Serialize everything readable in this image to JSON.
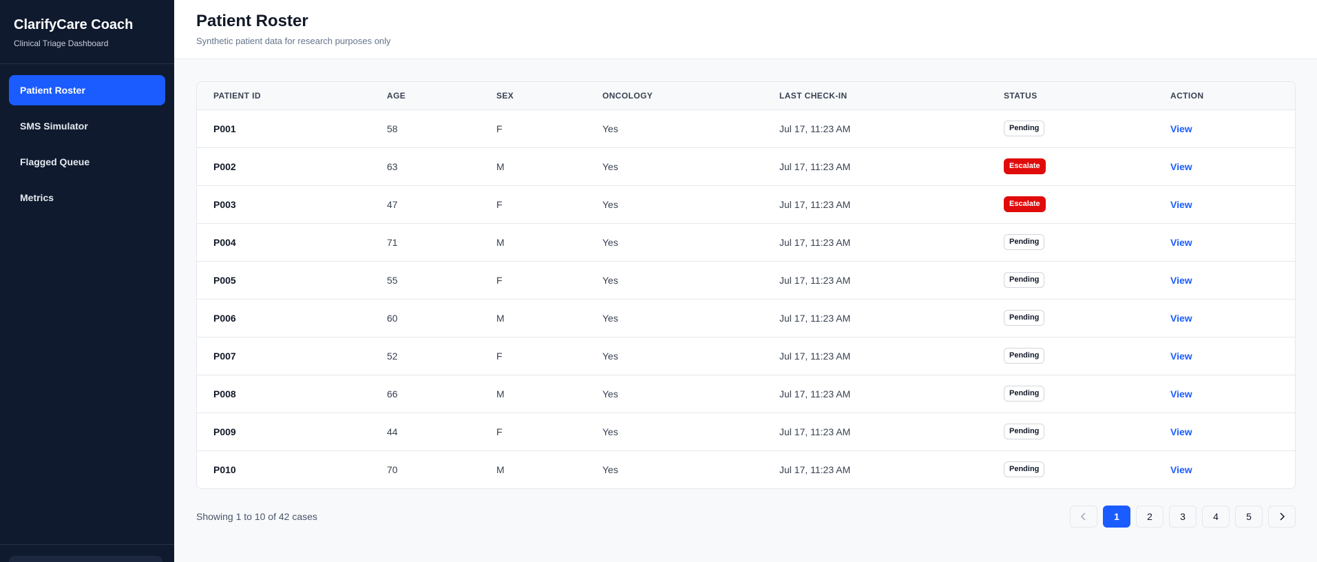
{
  "brand": {
    "title": "ClarifyCare Coach",
    "subtitle": "Clinical Triage Dashboard"
  },
  "nav": [
    {
      "label": "Patient Roster",
      "active": true
    },
    {
      "label": "SMS Simulator",
      "active": false
    },
    {
      "label": "Flagged Queue",
      "active": false
    },
    {
      "label": "Metrics",
      "active": false
    }
  ],
  "header": {
    "title": "Patient Roster",
    "subtitle": "Synthetic patient data for research purposes only"
  },
  "table": {
    "columns": [
      "PATIENT ID",
      "AGE",
      "SEX",
      "ONCOLOGY",
      "LAST CHECK-IN",
      "STATUS",
      "ACTION"
    ],
    "rows": [
      {
        "id": "P001",
        "age": "58",
        "sex": "F",
        "oncology": "Yes",
        "checkin": "Jul 17, 11:23 AM",
        "status": "Pending",
        "action": "View"
      },
      {
        "id": "P002",
        "age": "63",
        "sex": "M",
        "oncology": "Yes",
        "checkin": "Jul 17, 11:23 AM",
        "status": "Escalate",
        "action": "View"
      },
      {
        "id": "P003",
        "age": "47",
        "sex": "F",
        "oncology": "Yes",
        "checkin": "Jul 17, 11:23 AM",
        "status": "Escalate",
        "action": "View"
      },
      {
        "id": "P004",
        "age": "71",
        "sex": "M",
        "oncology": "Yes",
        "checkin": "Jul 17, 11:23 AM",
        "status": "Pending",
        "action": "View"
      },
      {
        "id": "P005",
        "age": "55",
        "sex": "F",
        "oncology": "Yes",
        "checkin": "Jul 17, 11:23 AM",
        "status": "Pending",
        "action": "View"
      },
      {
        "id": "P006",
        "age": "60",
        "sex": "M",
        "oncology": "Yes",
        "checkin": "Jul 17, 11:23 AM",
        "status": "Pending",
        "action": "View"
      },
      {
        "id": "P007",
        "age": "52",
        "sex": "F",
        "oncology": "Yes",
        "checkin": "Jul 17, 11:23 AM",
        "status": "Pending",
        "action": "View"
      },
      {
        "id": "P008",
        "age": "66",
        "sex": "M",
        "oncology": "Yes",
        "checkin": "Jul 17, 11:23 AM",
        "status": "Pending",
        "action": "View"
      },
      {
        "id": "P009",
        "age": "44",
        "sex": "F",
        "oncology": "Yes",
        "checkin": "Jul 17, 11:23 AM",
        "status": "Pending",
        "action": "View"
      },
      {
        "id": "P010",
        "age": "70",
        "sex": "M",
        "oncology": "Yes",
        "checkin": "Jul 17, 11:23 AM",
        "status": "Pending",
        "action": "View"
      }
    ]
  },
  "pagination": {
    "showing": "Showing 1 to 10 of 42 cases",
    "pages": [
      "1",
      "2",
      "3",
      "4",
      "5"
    ],
    "current": "1",
    "prev_icon": "chevron-left-icon",
    "next_icon": "chevron-right-icon"
  },
  "colors": {
    "sidebar_bg": "#101a2e",
    "accent": "#1a5cff",
    "escalate": "#e00b0b"
  }
}
